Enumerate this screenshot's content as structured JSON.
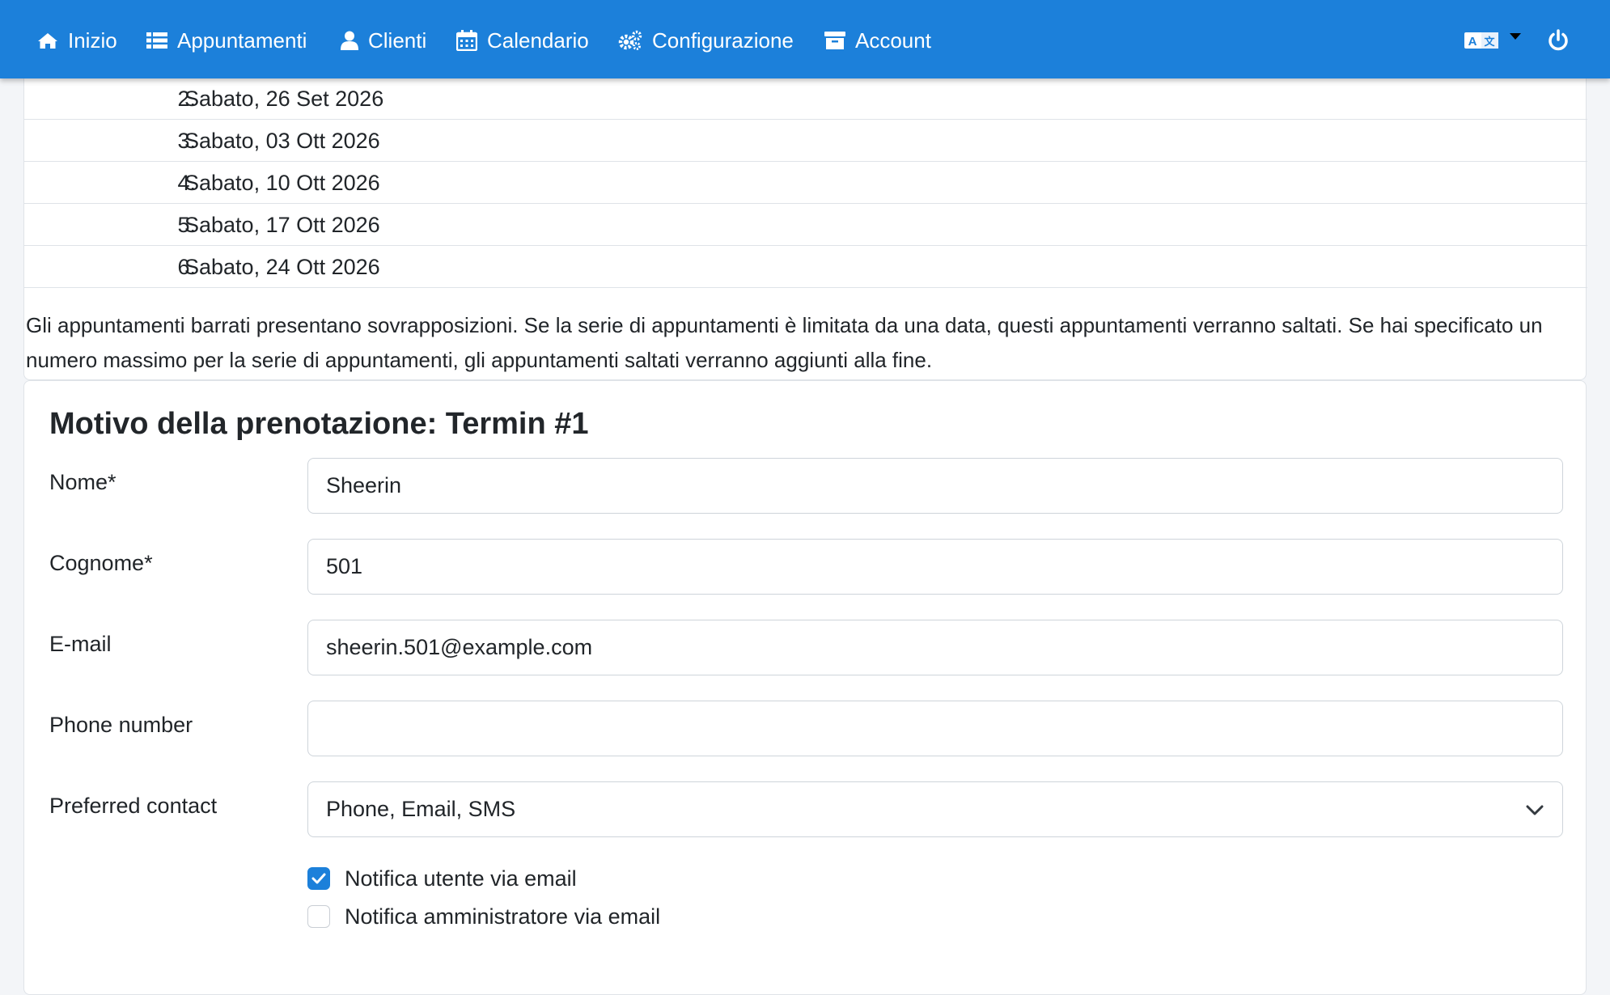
{
  "nav": {
    "items": [
      {
        "label": "Inizio",
        "icon": "home-icon"
      },
      {
        "label": "Appuntamenti",
        "icon": "list-icon"
      },
      {
        "label": "Clienti",
        "icon": "user-icon"
      },
      {
        "label": "Calendario",
        "icon": "calendar-icon"
      },
      {
        "label": "Configurazione",
        "icon": "gears-icon"
      },
      {
        "label": "Account",
        "icon": "archive-icon"
      }
    ],
    "right": {
      "language_icon": "translate-icon",
      "dropdown_icon": "caret-down-icon",
      "power_icon": "power-icon"
    },
    "color": "#1c80da"
  },
  "dates": [
    {
      "num": "2.",
      "text": "Sabato, 26 Set 2026"
    },
    {
      "num": "3.",
      "text": "Sabato, 03 Ott 2026"
    },
    {
      "num": "4.",
      "text": "Sabato, 10 Ott 2026"
    },
    {
      "num": "5.",
      "text": "Sabato, 17 Ott 2026"
    },
    {
      "num": "6.",
      "text": "Sabato, 24 Ott 2026"
    }
  ],
  "note": "Gli appuntamenti barrati presentano sovrapposizioni. Se la serie di appuntamenti è limitata da una data, questi appuntamenti verranno saltati. Se hai specificato un numero massimo per la serie di appuntamenti, gli appuntamenti saltati verranno aggiunti alla fine.",
  "form": {
    "title": "Motivo della prenotazione: Termin #1",
    "nome_label": "Nome*",
    "nome_value": "Sheerin",
    "cognome_label": "Cognome*",
    "cognome_value": "501",
    "email_label": "E-mail",
    "email_value": "sheerin.501@example.com",
    "phone_label": "Phone number",
    "phone_value": "",
    "contact_label": "Preferred contact",
    "contact_value": "Phone, Email, SMS",
    "notify_user_label": "Notifica utente via email",
    "notify_user_checked": true,
    "notify_admin_label": "Notifica amministratore via email",
    "notify_admin_checked": false
  }
}
